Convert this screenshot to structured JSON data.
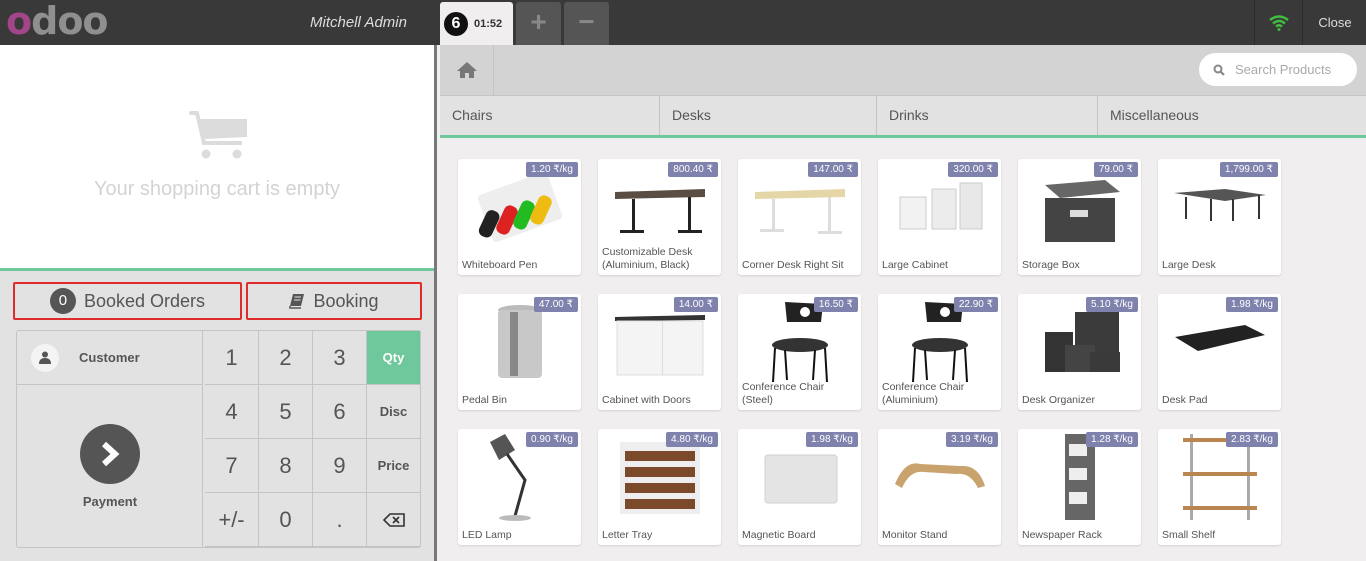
{
  "topbar": {
    "logo": [
      "o",
      "d",
      "o",
      "o"
    ],
    "user": "Mitchell Admin",
    "order_tab": {
      "number": "6",
      "time": "01:52"
    },
    "add_order": "+",
    "remove_order": "−",
    "close_label": "Close",
    "wifi_color": "#3fbf3f"
  },
  "cart": {
    "empty_message": "Your shopping cart is empty"
  },
  "controls": {
    "booked_orders_count": "0",
    "booked_orders_label": "Booked Orders",
    "booking_label": "Booking"
  },
  "actionpad": {
    "customer_label": "Customer",
    "payment_label": "Payment"
  },
  "numpad": {
    "keys": [
      "1",
      "2",
      "3",
      "Qty",
      "4",
      "5",
      "6",
      "Disc",
      "7",
      "8",
      "9",
      "Price",
      "+/-",
      "0",
      ".",
      "⌫"
    ],
    "selected_mode": "Qty"
  },
  "search": {
    "placeholder": "Search Products"
  },
  "categories": [
    "Chairs",
    "Desks",
    "Drinks",
    "Miscellaneous"
  ],
  "accent_color": "#6ec89b",
  "price_badge_color": "#7f82ac",
  "products": [
    {
      "name": "Whiteboard Pen",
      "price": "1.20 ₹/kg",
      "icon": "pens"
    },
    {
      "name": "Customizable Desk (Aluminium, Black)",
      "price": "800.40 ₹",
      "icon": "desk-dark"
    },
    {
      "name": "Corner Desk Right Sit",
      "price": "147.00 ₹",
      "icon": "desk-light"
    },
    {
      "name": "Large Cabinet",
      "price": "320.00 ₹",
      "icon": "cabinet"
    },
    {
      "name": "Storage Box",
      "price": "79.00 ₹",
      "icon": "box"
    },
    {
      "name": "Large Desk",
      "price": "1,799.00 ₹",
      "icon": "desk-large"
    },
    {
      "name": "Pedal Bin",
      "price": "47.00 ₹",
      "icon": "bin"
    },
    {
      "name": "Cabinet with Doors",
      "price": "14.00 ₹",
      "icon": "cabinet-doors"
    },
    {
      "name": "Conference Chair (Steel)",
      "price": "16.50 ₹",
      "icon": "chair"
    },
    {
      "name": "Conference Chair (Aluminium)",
      "price": "22.90 ₹",
      "icon": "chair"
    },
    {
      "name": "Desk Organizer",
      "price": "5.10 ₹/kg",
      "icon": "organizer"
    },
    {
      "name": "Desk Pad",
      "price": "1.98 ₹/kg",
      "icon": "pad"
    },
    {
      "name": "LED Lamp",
      "price": "0.90 ₹/kg",
      "icon": "lamp"
    },
    {
      "name": "Letter Tray",
      "price": "4.80 ₹/kg",
      "icon": "tray"
    },
    {
      "name": "Magnetic Board",
      "price": "1.98 ₹/kg",
      "icon": "board"
    },
    {
      "name": "Monitor Stand",
      "price": "3.19 ₹/kg",
      "icon": "stand"
    },
    {
      "name": "Newspaper Rack",
      "price": "1.28 ₹/kg",
      "icon": "rack"
    },
    {
      "name": "Small Shelf",
      "price": "2.83 ₹/kg",
      "icon": "shelf"
    }
  ]
}
